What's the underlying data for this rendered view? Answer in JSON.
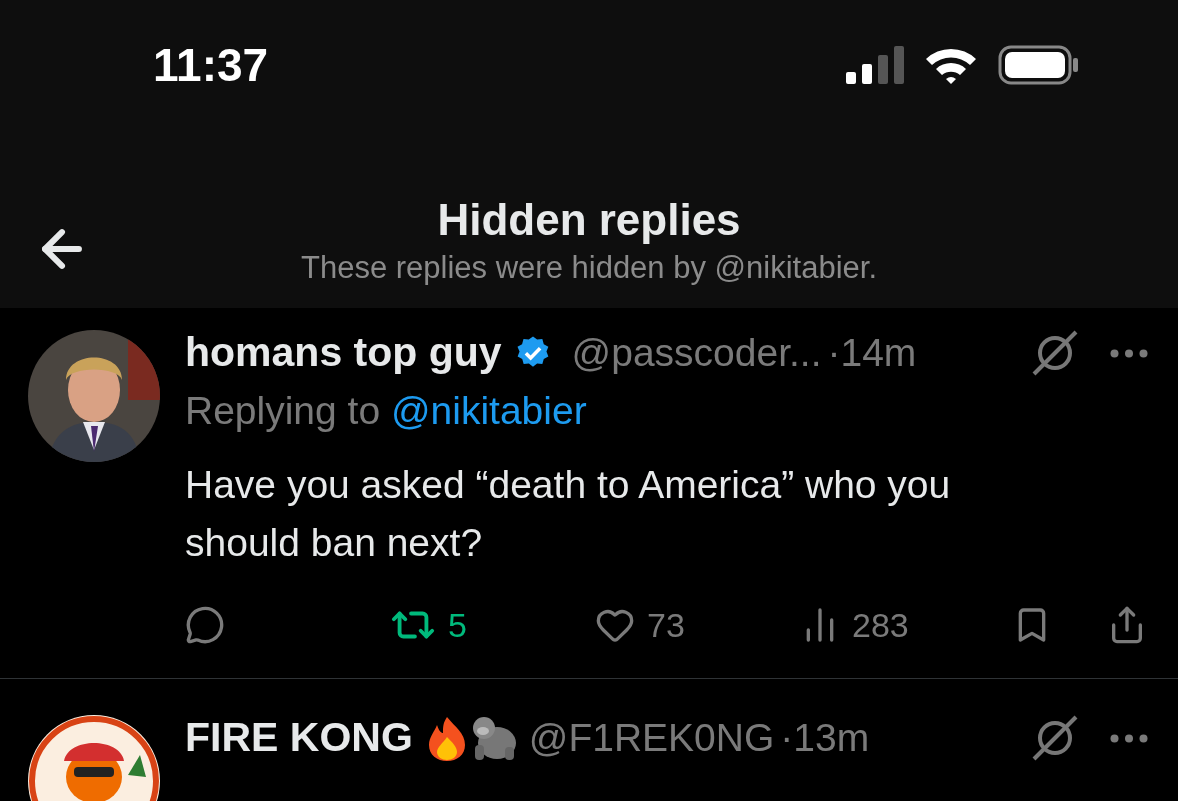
{
  "status_bar": {
    "time": "11:37"
  },
  "header": {
    "title": "Hidden replies",
    "subtitle": "These replies were hidden by @nikitabier."
  },
  "tweets": [
    {
      "name": "homans top guy",
      "verified": true,
      "handle": "@passcoder...",
      "time": "·14m",
      "replying_prefix": "Replying to",
      "replying_handle": "@nikitabier",
      "body": "Have you asked “death to America” who you should ban next?",
      "actions": [
        {
          "kind": "reply"
        },
        {
          "kind": "repost",
          "count": "5",
          "on": true
        },
        {
          "kind": "like",
          "count": "73",
          "on": false
        },
        {
          "kind": "views",
          "count": "283"
        },
        {
          "kind": "bookmark",
          "on": false
        },
        {
          "kind": "share"
        }
      ]
    },
    {
      "name": "FIRE KONG",
      "verified": false,
      "emoji": [
        {
          "kind": "fire"
        },
        {
          "kind": "gorilla"
        }
      ],
      "handle": "@F1REK0NG",
      "time": "·13m"
    }
  ]
}
